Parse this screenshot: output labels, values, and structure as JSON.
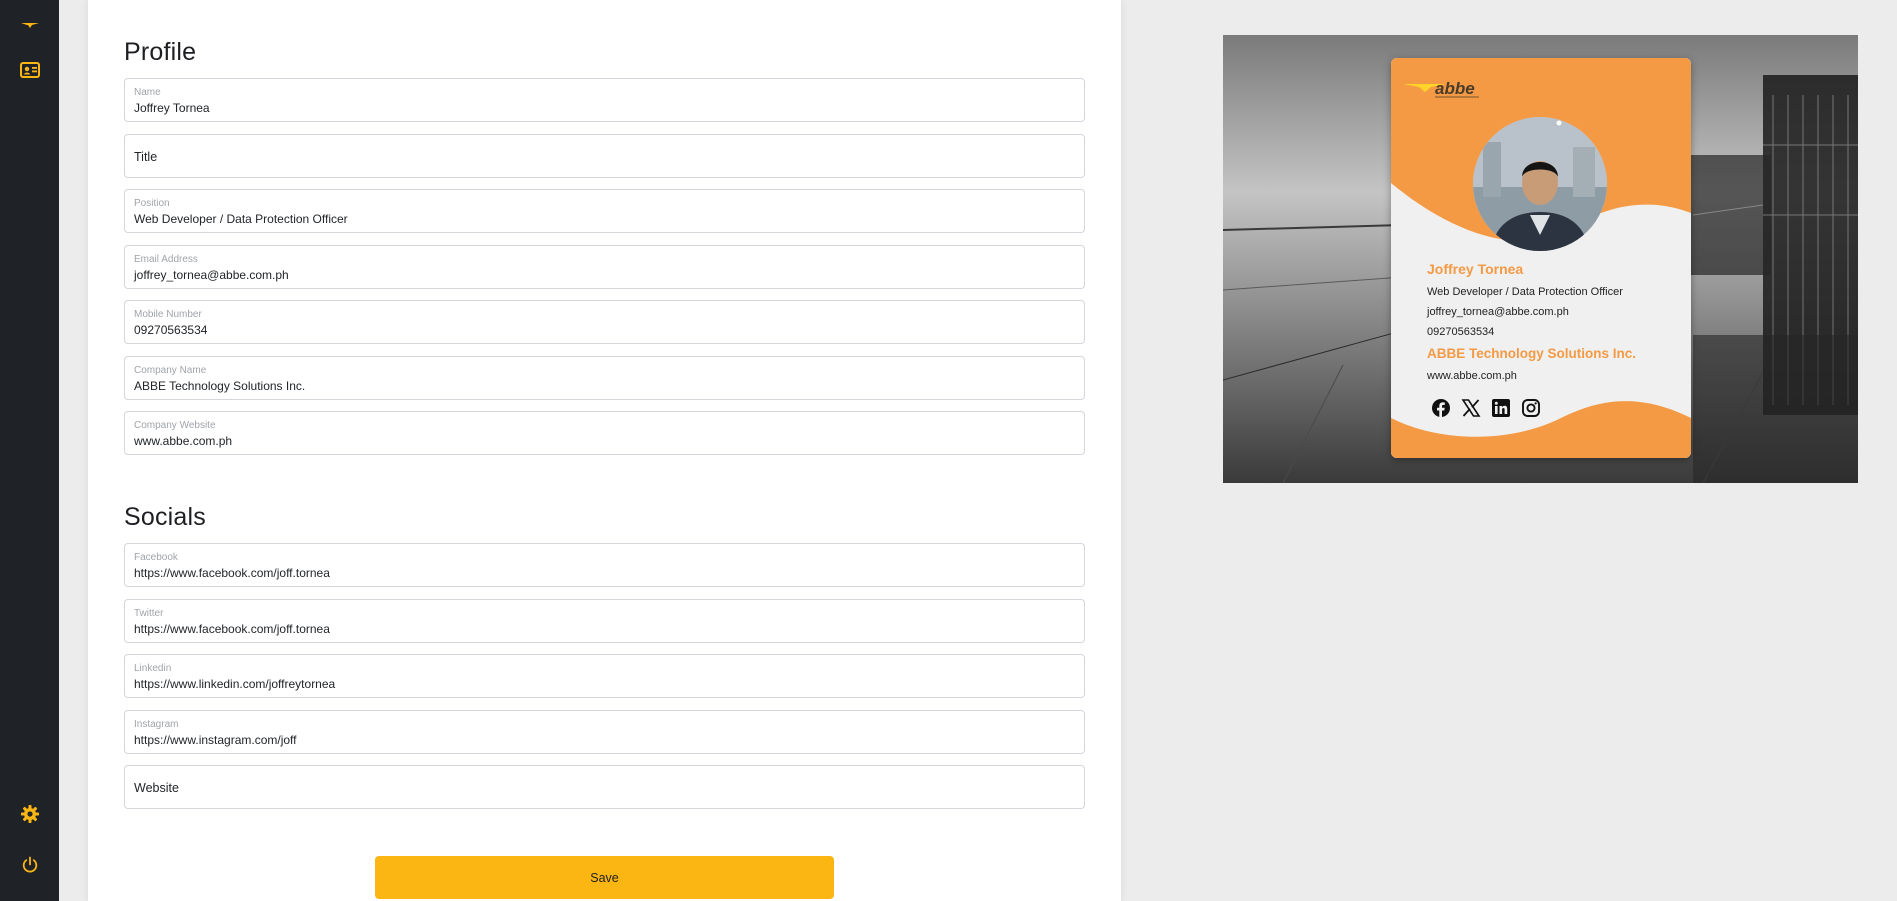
{
  "sidebar": {
    "icons": [
      "logo-icon",
      "id-card-icon",
      "gear-icon",
      "power-icon"
    ]
  },
  "profile": {
    "title": "Profile",
    "fields": [
      {
        "label": "Name",
        "value": "Joffrey Tornea"
      },
      {
        "placeholder": "Title"
      },
      {
        "label": "Position",
        "value": "Web Developer / Data Protection Officer"
      },
      {
        "label": "Email Address",
        "value": "joffrey_tornea@abbe.com.ph"
      },
      {
        "label": "Mobile Number",
        "value": "09270563534"
      },
      {
        "label": "Company Name",
        "value": "ABBE Technology Solutions Inc."
      },
      {
        "label": "Company Website",
        "value": "www.abbe.com.ph"
      }
    ]
  },
  "socials": {
    "title": "Socials",
    "fields": [
      {
        "label": "Facebook",
        "value": "https://www.facebook.com/joff.tornea"
      },
      {
        "label": "Twitter",
        "value": "https://www.facebook.com/joff.tornea"
      },
      {
        "label": "Linkedin",
        "value": "https://www.linkedin.com/joffreytornea"
      },
      {
        "label": "Instagram",
        "value": "https://www.instagram.com/joff"
      },
      {
        "placeholder": "Website"
      }
    ]
  },
  "save_label": "Save",
  "card": {
    "logo_text": "abbe",
    "name": "Joffrey Tornea",
    "position": "Web Developer / Data Protection Officer",
    "email": "joffrey_tornea@abbe.com.ph",
    "mobile": "09270563534",
    "company": "ABBE Technology Solutions Inc.",
    "website": "www.abbe.com.ph",
    "social_icons": [
      "facebook-icon",
      "x-icon",
      "linkedin-icon",
      "instagram-icon"
    ]
  },
  "colors": {
    "accent": "#fbb614",
    "card_orange": "#f59a44",
    "sidebar": "#1f2327"
  }
}
